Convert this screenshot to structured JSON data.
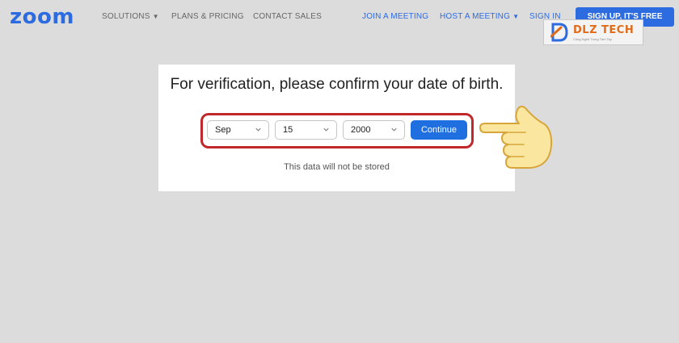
{
  "header": {
    "logo": "zoom",
    "nav_left": [
      {
        "label": "SOLUTIONS",
        "dropdown": true
      },
      {
        "label": "PLANS & PRICING",
        "dropdown": false
      },
      {
        "label": "CONTACT SALES",
        "dropdown": false
      }
    ],
    "nav_right": [
      {
        "label": "JOIN A MEETING",
        "dropdown": false
      },
      {
        "label": "HOST A MEETING",
        "dropdown": true
      },
      {
        "label": "SIGN IN",
        "dropdown": false
      }
    ],
    "signup_label": "SIGN UP, IT'S FREE"
  },
  "watermark": {
    "brand": "DLZ TECH",
    "tagline": "Công Nghệ Trong Tầm Tay"
  },
  "dialog": {
    "title": "For verification, please confirm your date of birth.",
    "month": "Sep",
    "day": "15",
    "year": "2000",
    "continue_label": "Continue",
    "note": "This data will not be stored"
  },
  "colors": {
    "brand_blue": "#2d6be0",
    "button_blue": "#1f6fe0",
    "highlight_red": "#c0282c",
    "page_bg": "#dcdcdc"
  },
  "icons": {
    "dropdown": "chevron-down-icon",
    "pointer": "pointing-hand-icon"
  }
}
